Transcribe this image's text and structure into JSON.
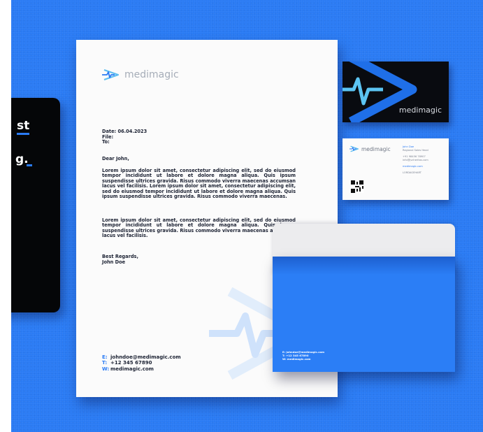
{
  "brand": {
    "name": "medimagic",
    "accent": "#2a7bf4",
    "background": "#2a7bf4"
  },
  "dark_card": {
    "line1": "st",
    "line2": "g."
  },
  "letterhead": {
    "date": "Date: 06.04.2023",
    "file": "File:",
    "to": "To:",
    "greeting": "Dear John,",
    "paragraph1": "Lorem ipsum dolor sit amet, consectetur adipiscing elit, sed do eiusmod tempor incididunt ut labore et dolore magna aliqua. Quis ipsum suspendisse ultrices gravida. Risus commodo viverra maecenas accumsan lacus vel facilisis. Lorem ipsum dolor sit amet, consectetur adipiscing elit, sed do eiusmod tempor incididunt ut labore et dolore magna aliqua. Quis ipsum suspendisse ultrices gravida. Risus commodo viverra maecenas.",
    "paragraph2": "Lorem ipsum dolor sit amet, consectetur adipiscing elit, sed do eiusmod tempor incididunt ut labore et dolore magna aliqua. Quis ipsum suspendisse ultrices gravida. Risus commodo viverra maecenas accumsan lacus vel facilisis.",
    "closing": "Best Regards,",
    "signature": "John Doe",
    "contact": {
      "email_key": "E:",
      "email": "johndoe@medimagic.com",
      "phone_key": "T:",
      "phone": "+12 345 67890",
      "web_key": "W:",
      "web": "medimagic.com"
    }
  },
  "business_card_front": {
    "name": "John Doe",
    "title": "Regional Sales Head",
    "phone": "+91 98456 78907",
    "email": "info@jvcheritas.com",
    "web": "medimagic.com",
    "footer": "LORDAGEHART"
  },
  "envelope": {
    "email": "E: johndoe@medimagic.com",
    "phone": "T: +12 345 67890",
    "web": "W: medimagic.com"
  }
}
